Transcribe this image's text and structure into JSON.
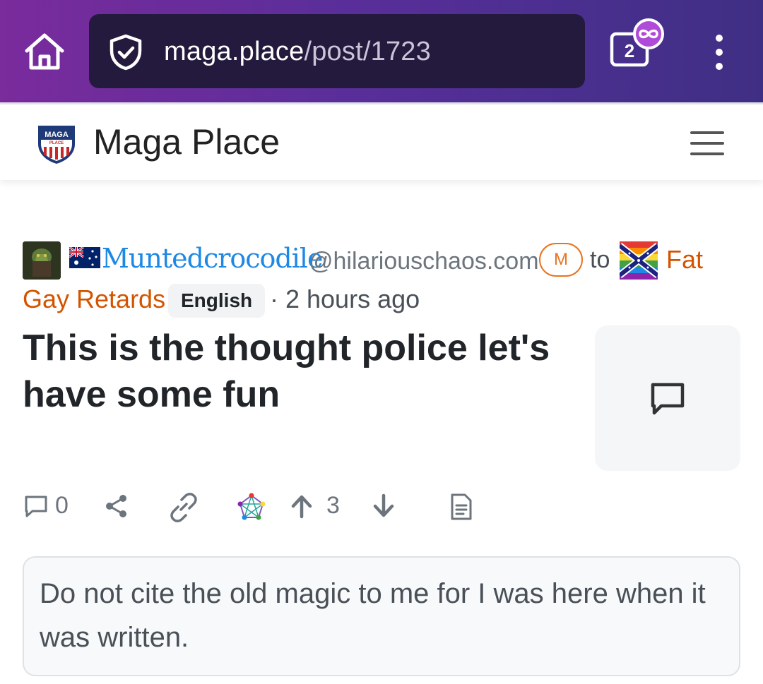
{
  "browser": {
    "url_domain": "maga.place",
    "url_path": "/post/1723",
    "tab_count": "2"
  },
  "site": {
    "title": "Maga Place",
    "logo_text_top": "MAGA",
    "logo_text_bottom": "PLACE"
  },
  "post": {
    "author": "Muntedcrocodile",
    "author_instance": "@hilariouschaos.com",
    "mod_badge": "M",
    "to_label": "to",
    "community_line1": "Fat",
    "community_line2": "Gay Retards",
    "language": "English",
    "time": "· 2 hours ago",
    "title": "This is the thought police let's have some fun",
    "comment_count": "0",
    "score": "3",
    "body": "Do not cite the old magic to me for I was here when it was written."
  },
  "colors": {
    "browser_gradient_start": "#7a2b9c",
    "browser_gradient_end": "#3f2f84",
    "url_box": "#231a3d",
    "author_link": "#1e88e5",
    "community_link": "#d35400",
    "mod_badge": "#e8731f"
  },
  "icons": {
    "home": "home-icon",
    "shield": "shield-check-icon",
    "tabs": "tabs-incognito-icon",
    "more": "more-vertical-icon",
    "menu": "hamburger-menu-icon",
    "comments": "comment-icon",
    "share": "share-icon",
    "link": "link-icon",
    "fediverse": "fediverse-icon",
    "upvote": "arrow-up-icon",
    "downvote": "arrow-down-icon",
    "source": "document-icon"
  }
}
